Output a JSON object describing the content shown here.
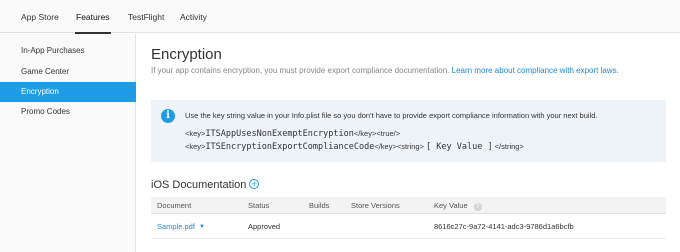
{
  "topnav": {
    "tabs": [
      {
        "label": "App Store"
      },
      {
        "label": "Features"
      },
      {
        "label": "TestFlight"
      },
      {
        "label": "Activity"
      }
    ]
  },
  "sidebar": {
    "items": [
      {
        "label": "In-App Purchases"
      },
      {
        "label": "Game Center"
      },
      {
        "label": "Encryption"
      },
      {
        "label": "Promo Codes"
      }
    ]
  },
  "main": {
    "title": "Encryption",
    "subtitle": "If your app contains encryption, you must provide export compliance documentation.",
    "subtitle_link": "Learn more about compliance with export laws.",
    "info": {
      "icon": "info-icon",
      "text": "Use the key string value in your Info.plist file so you don't have to provide export compliance information with your next build.",
      "line1": {
        "open_tag": "<key>",
        "key": "ITSAppUsesNonExemptEncryption",
        "rest": "</key><true/>"
      },
      "line2": {
        "open_tag": "<key>",
        "key": "ITSEncryptionExportComplianceCode",
        "mid": "</key><string>",
        "value": "[ Key Value ]",
        "close": "</string>"
      }
    },
    "documentation": {
      "title": "iOS Documentation",
      "add_icon": "plus-circle-icon",
      "columns": [
        "Document",
        "Status",
        "Builds",
        "Store Versions",
        "Key Value"
      ],
      "help_icon": "question-icon",
      "rows": [
        {
          "document": "Sample.pdf",
          "status": "Approved",
          "builds": "",
          "store_versions": "",
          "key_value": "8616c27c-9a72-4141-adc3-9786d1a6bcfb"
        }
      ]
    }
  }
}
